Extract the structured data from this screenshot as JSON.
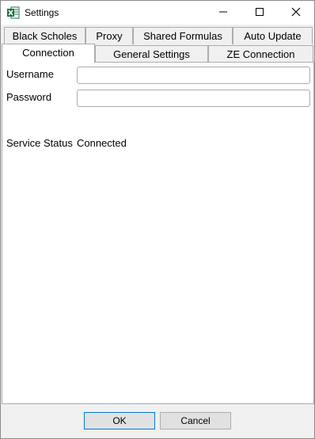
{
  "window": {
    "title": "Settings",
    "app_icon": "excel-icon",
    "controls": [
      "minimize-icon",
      "maximize-icon",
      "close-icon"
    ]
  },
  "tabs": {
    "row_back": [
      "Black Scholes",
      "Proxy",
      "Shared Formulas",
      "Auto Update"
    ],
    "row_front": [
      "Connection",
      "General Settings",
      "ZE Connection"
    ],
    "active": "Connection"
  },
  "connection": {
    "username_label": "Username",
    "username_value": "",
    "password_label": "Password",
    "password_value": "",
    "status_label": "Service Status",
    "status_value": "Connected"
  },
  "footer": {
    "ok_label": "OK",
    "cancel_label": "Cancel"
  },
  "colors": {
    "accent": "#0078d7",
    "excel_green": "#1e7145"
  }
}
